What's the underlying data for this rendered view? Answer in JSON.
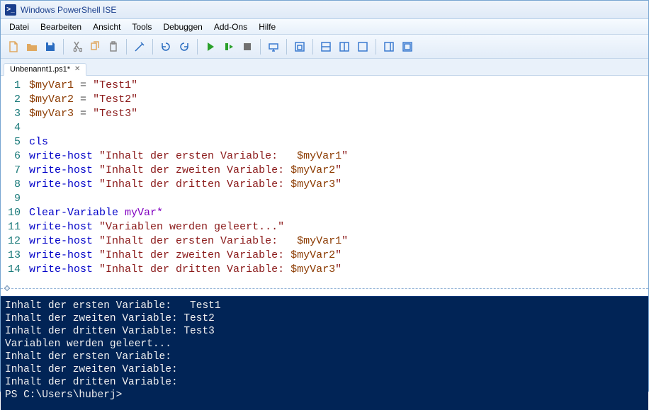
{
  "window": {
    "title": "Windows PowerShell ISE"
  },
  "menu": {
    "items": [
      "Datei",
      "Bearbeiten",
      "Ansicht",
      "Tools",
      "Debuggen",
      "Add-Ons",
      "Hilfe"
    ]
  },
  "toolbar": {
    "buttons": [
      {
        "name": "new-file-icon",
        "color": "#e0a860"
      },
      {
        "name": "open-file-icon",
        "color": "#e0a860"
      },
      {
        "name": "save-icon",
        "color": "#2a6cc0"
      },
      {
        "sep": true
      },
      {
        "name": "cut-icon",
        "color": "#8a8a8a"
      },
      {
        "name": "copy-icon",
        "color": "#e0a860"
      },
      {
        "name": "paste-icon",
        "color": "#8a8a8a"
      },
      {
        "sep": true
      },
      {
        "name": "clear-icon",
        "color": "#2a6cc0"
      },
      {
        "sep": true
      },
      {
        "name": "undo-icon",
        "color": "#2a6cc0"
      },
      {
        "name": "redo-icon",
        "color": "#2a6cc0"
      },
      {
        "sep": true
      },
      {
        "name": "run-icon",
        "color": "#2aa02a"
      },
      {
        "name": "run-selection-icon",
        "color": "#2aa02a"
      },
      {
        "name": "stop-icon",
        "color": "#707070"
      },
      {
        "sep": true
      },
      {
        "name": "remote-icon",
        "color": "#3a7ad0"
      },
      {
        "sep": true
      },
      {
        "name": "new-tab-icon",
        "color": "#3a7ad0"
      },
      {
        "sep": true
      },
      {
        "name": "layout1-icon",
        "color": "#3a7ad0"
      },
      {
        "name": "layout2-icon",
        "color": "#3a7ad0"
      },
      {
        "name": "layout3-icon",
        "color": "#3a7ad0"
      },
      {
        "sep": true
      },
      {
        "name": "commands-pane-icon",
        "color": "#3a7ad0"
      },
      {
        "name": "maximize-pane-icon",
        "color": "#3a7ad0"
      }
    ]
  },
  "tab": {
    "label": "Unbenannt1.ps1*"
  },
  "code_lines": [
    [
      {
        "t": "var",
        "v": "$myVar1"
      },
      {
        "t": "sp",
        "v": " "
      },
      {
        "t": "op",
        "v": "="
      },
      {
        "t": "sp",
        "v": " "
      },
      {
        "t": "str",
        "v": "\"Test1\""
      }
    ],
    [
      {
        "t": "var",
        "v": "$myVar2"
      },
      {
        "t": "sp",
        "v": " "
      },
      {
        "t": "op",
        "v": "="
      },
      {
        "t": "sp",
        "v": " "
      },
      {
        "t": "str",
        "v": "\"Test2\""
      }
    ],
    [
      {
        "t": "var",
        "v": "$myVar3"
      },
      {
        "t": "sp",
        "v": " "
      },
      {
        "t": "op",
        "v": "="
      },
      {
        "t": "sp",
        "v": " "
      },
      {
        "t": "str",
        "v": "\"Test3\""
      }
    ],
    [],
    [
      {
        "t": "cmd",
        "v": "cls"
      }
    ],
    [
      {
        "t": "cmd",
        "v": "write-host"
      },
      {
        "t": "sp",
        "v": " "
      },
      {
        "t": "str",
        "v": "\"Inhalt der ersten Variable:   "
      },
      {
        "t": "var",
        "v": "$myVar1"
      },
      {
        "t": "str",
        "v": "\""
      }
    ],
    [
      {
        "t": "cmd",
        "v": "write-host"
      },
      {
        "t": "sp",
        "v": " "
      },
      {
        "t": "str",
        "v": "\"Inhalt der zweiten Variable: "
      },
      {
        "t": "var",
        "v": "$myVar2"
      },
      {
        "t": "str",
        "v": "\""
      }
    ],
    [
      {
        "t": "cmd",
        "v": "write-host"
      },
      {
        "t": "sp",
        "v": " "
      },
      {
        "t": "str",
        "v": "\"Inhalt der dritten Variable: "
      },
      {
        "t": "var",
        "v": "$myVar3"
      },
      {
        "t": "str",
        "v": "\""
      }
    ],
    [],
    [
      {
        "t": "cmd",
        "v": "Clear-Variable"
      },
      {
        "t": "sp",
        "v": " "
      },
      {
        "t": "arg",
        "v": "myVar*"
      }
    ],
    [
      {
        "t": "cmd",
        "v": "write-host"
      },
      {
        "t": "sp",
        "v": " "
      },
      {
        "t": "str",
        "v": "\"Variablen werden geleert...\""
      }
    ],
    [
      {
        "t": "cmd",
        "v": "write-host"
      },
      {
        "t": "sp",
        "v": " "
      },
      {
        "t": "str",
        "v": "\"Inhalt der ersten Variable:   "
      },
      {
        "t": "var",
        "v": "$myVar1"
      },
      {
        "t": "str",
        "v": "\""
      }
    ],
    [
      {
        "t": "cmd",
        "v": "write-host"
      },
      {
        "t": "sp",
        "v": " "
      },
      {
        "t": "str",
        "v": "\"Inhalt der zweiten Variable: "
      },
      {
        "t": "var",
        "v": "$myVar2"
      },
      {
        "t": "str",
        "v": "\""
      }
    ],
    [
      {
        "t": "cmd",
        "v": "write-host"
      },
      {
        "t": "sp",
        "v": " "
      },
      {
        "t": "str",
        "v": "\"Inhalt der dritten Variable: "
      },
      {
        "t": "var",
        "v": "$myVar3"
      },
      {
        "t": "str",
        "v": "\""
      }
    ]
  ],
  "console_lines": [
    "Inhalt der ersten Variable:   Test1",
    "Inhalt der zweiten Variable: Test2",
    "Inhalt der dritten Variable: Test3",
    "Variablen werden geleert...",
    "Inhalt der ersten Variable:   ",
    "Inhalt der zweiten Variable: ",
    "Inhalt der dritten Variable: ",
    "PS C:\\Users\\huberj> "
  ]
}
